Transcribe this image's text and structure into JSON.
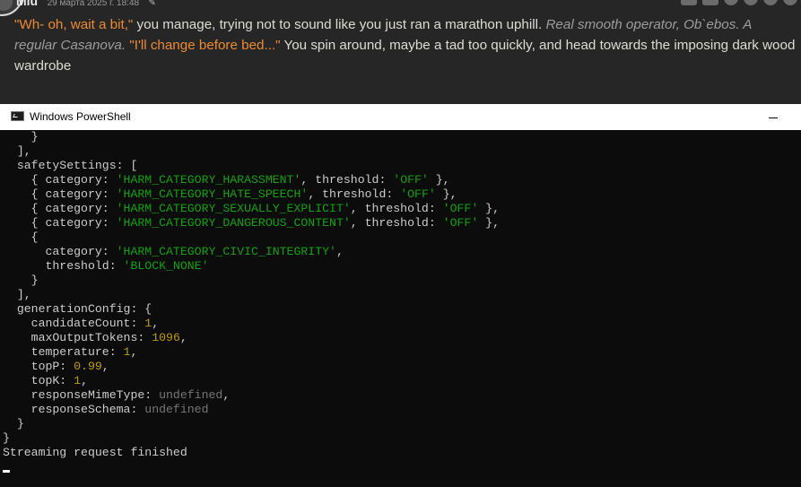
{
  "chat": {
    "author": "Miu",
    "date": "29 марта 2025 г. 18:48",
    "text": {
      "q1": "\"Wh- oh, wait a bit,\"",
      "t1": " you manage, trying not to sound like you just ran a marathon uphill. ",
      "i1": "Real smooth operator, Ob`ebos. A regular Casanova.",
      "sp": " ",
      "q2": "\"I'll change before bed...\"",
      "t2": " You spin around, maybe a tad too quickly, and head towards the imposing dark wood wardrobe"
    }
  },
  "window": {
    "title": "Windows PowerShell",
    "icon": "powershell-icon"
  },
  "console": {
    "lines": [
      [
        {
          "t": "    }"
        }
      ],
      [
        {
          "t": "  ],"
        }
      ],
      [
        {
          "t": "  safetySettings: ["
        }
      ],
      [
        {
          "t": "    { category: "
        },
        {
          "t": "'HARM_CATEGORY_HARASSMENT'",
          "c": "s"
        },
        {
          "t": ", threshold: "
        },
        {
          "t": "'OFF'",
          "c": "s"
        },
        {
          "t": " },"
        }
      ],
      [
        {
          "t": "    { category: "
        },
        {
          "t": "'HARM_CATEGORY_HATE_SPEECH'",
          "c": "s"
        },
        {
          "t": ", threshold: "
        },
        {
          "t": "'OFF'",
          "c": "s"
        },
        {
          "t": " },"
        }
      ],
      [
        {
          "t": "    { category: "
        },
        {
          "t": "'HARM_CATEGORY_SEXUALLY_EXPLICIT'",
          "c": "s"
        },
        {
          "t": ", threshold: "
        },
        {
          "t": "'OFF'",
          "c": "s"
        },
        {
          "t": " },"
        }
      ],
      [
        {
          "t": "    { category: "
        },
        {
          "t": "'HARM_CATEGORY_DANGEROUS_CONTENT'",
          "c": "s"
        },
        {
          "t": ", threshold: "
        },
        {
          "t": "'OFF'",
          "c": "s"
        },
        {
          "t": " },"
        }
      ],
      [
        {
          "t": "    {"
        }
      ],
      [
        {
          "t": "      category: "
        },
        {
          "t": "'HARM_CATEGORY_CIVIC_INTEGRITY'",
          "c": "s"
        },
        {
          "t": ","
        }
      ],
      [
        {
          "t": "      threshold: "
        },
        {
          "t": "'BLOCK_NONE'",
          "c": "s"
        }
      ],
      [
        {
          "t": "    }"
        }
      ],
      [
        {
          "t": "  ],"
        }
      ],
      [
        {
          "t": "  generationConfig: {"
        }
      ],
      [
        {
          "t": "    candidateCount: "
        },
        {
          "t": "1",
          "c": "n"
        },
        {
          "t": ","
        }
      ],
      [
        {
          "t": "    maxOutputTokens: "
        },
        {
          "t": "1096",
          "c": "n"
        },
        {
          "t": ","
        }
      ],
      [
        {
          "t": "    temperature: "
        },
        {
          "t": "1",
          "c": "n"
        },
        {
          "t": ","
        }
      ],
      [
        {
          "t": "    topP: "
        },
        {
          "t": "0.99",
          "c": "n"
        },
        {
          "t": ","
        }
      ],
      [
        {
          "t": "    topK: "
        },
        {
          "t": "1",
          "c": "n"
        },
        {
          "t": ","
        }
      ],
      [
        {
          "t": "    responseMimeType: "
        },
        {
          "t": "undefined",
          "c": "u"
        },
        {
          "t": ","
        }
      ],
      [
        {
          "t": "    responseSchema: "
        },
        {
          "t": "undefined",
          "c": "u"
        }
      ],
      [
        {
          "t": "  }"
        }
      ],
      [
        {
          "t": "}"
        }
      ],
      [
        {
          "t": "Streaming request finished"
        }
      ]
    ]
  },
  "colors": {
    "quote": "#ee8a2e",
    "string": "#13a10e",
    "number": "#c19c00",
    "undefined": "#767676",
    "console_bg": "#0c0c0c",
    "console_fg": "#cccccc"
  }
}
